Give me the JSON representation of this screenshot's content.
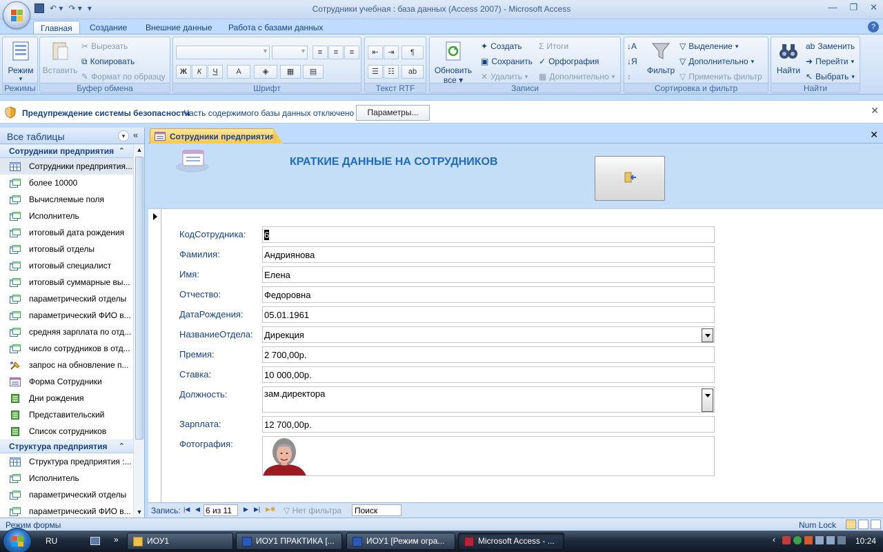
{
  "window": {
    "title": "Сотрудники учебная : база данных (Access 2007) - Microsoft Access",
    "minimize": "—",
    "restore": "❐",
    "close": "✕"
  },
  "ribbon_tabs": [
    {
      "label": "Главная",
      "active": true
    },
    {
      "label": "Создание",
      "active": false
    },
    {
      "label": "Внешние данные",
      "active": false
    },
    {
      "label": "Работа с базами данных",
      "active": false
    }
  ],
  "help_icon": "?",
  "ribbon": {
    "regimes": {
      "label": "Режимы",
      "button": "Режим"
    },
    "clipboard": {
      "label": "Буфер обмена",
      "paste": "Вставить",
      "cut": "Вырезать",
      "copy": "Копировать",
      "format_painter": "Формат по образцу"
    },
    "font": {
      "label": "Шрифт",
      "bold": "Ж",
      "italic": "К",
      "underline": "Ч",
      "font_color": "A"
    },
    "rtf": {
      "label": "Текст RTF"
    },
    "records": {
      "label": "Записи",
      "refresh": "Обновить",
      "refresh_sub": "все ▾",
      "new": "Создать",
      "save": "Сохранить",
      "delete": "Удалить",
      "totals": "Итоги",
      "spelling": "Орфография",
      "more": "Дополнительно"
    },
    "sort": {
      "label": "Сортировка и фильтр",
      "filter": "Фильтр",
      "selection": "Выделение",
      "advanced": "Дополнительно",
      "apply": "Применить фильтр"
    },
    "find": {
      "label": "Найти",
      "find": "Найти",
      "replace": "Заменить",
      "goto": "Перейти",
      "select": "Выбрать"
    }
  },
  "security_bar": {
    "title": "Предупреждение системы безопасности",
    "message": "Часть содержимого базы данных отключено",
    "button": "Параметры...",
    "close": "✕"
  },
  "nav_pane": {
    "header": "Все таблицы",
    "groups": [
      {
        "title": "Сотрудники предприятия",
        "items": [
          {
            "label": "Сотрудники предприятия...",
            "icon": "table-icon",
            "selected": true
          },
          {
            "label": "более 10000",
            "icon": "query-icon"
          },
          {
            "label": "Вычисляемые поля",
            "icon": "query-icon"
          },
          {
            "label": "Исполнитель",
            "icon": "query-icon"
          },
          {
            "label": "итоговый дата рождения",
            "icon": "query-icon"
          },
          {
            "label": "итоговый отделы",
            "icon": "query-icon"
          },
          {
            "label": "итоговый специалист",
            "icon": "query-icon"
          },
          {
            "label": "итоговый суммарные вы...",
            "icon": "query-icon"
          },
          {
            "label": "параметрический отделы",
            "icon": "query-icon"
          },
          {
            "label": "параметрический ФИО в...",
            "icon": "query-icon"
          },
          {
            "label": "средняя зарплата по отд...",
            "icon": "query-icon"
          },
          {
            "label": "число сотрудников в отд...",
            "icon": "query-icon"
          },
          {
            "label": "запрос на обновление п...",
            "icon": "update-query-icon"
          },
          {
            "label": "Форма Сотрудники",
            "icon": "form-icon"
          },
          {
            "label": "Дни рождения",
            "icon": "report-icon"
          },
          {
            "label": "Представительский",
            "icon": "report-icon"
          },
          {
            "label": "Список сотрудников",
            "icon": "report-icon"
          }
        ]
      },
      {
        "title": "Структура предприятия",
        "items": [
          {
            "label": "Структура предприятия :...",
            "icon": "table-icon"
          },
          {
            "label": "Исполнитель",
            "icon": "query-icon"
          },
          {
            "label": "параметрический отделы",
            "icon": "query-icon"
          },
          {
            "label": "параметрический ФИО в...",
            "icon": "query-icon"
          }
        ]
      }
    ]
  },
  "document_tab": {
    "label": "Сотрудники предприятия",
    "close": "✕"
  },
  "form": {
    "title": "КРАТКИЕ ДАННЫЕ НА СОТРУДНИКОВ",
    "fields": [
      {
        "label": "КодСотрудника:",
        "value": "6"
      },
      {
        "label": "Фамилия:",
        "value": "Андриянова"
      },
      {
        "label": "Имя:",
        "value": "Елена"
      },
      {
        "label": "Отчество:",
        "value": "Федоровна"
      },
      {
        "label": "ДатаРождения:",
        "value": "05.01.1961"
      },
      {
        "label": "НазваниеОтдела:",
        "value": "Дирекция"
      },
      {
        "label": "Премия:",
        "value": "2 700,00р."
      },
      {
        "label": "Ставка:",
        "value": "10 000,00р."
      },
      {
        "label": "Должность:",
        "value": "зам.директора"
      },
      {
        "label": "Зарплата:",
        "value": "12 700,00р."
      },
      {
        "label": "Фотография:",
        "value": ""
      }
    ]
  },
  "record_nav": {
    "label": "Запись:",
    "position": "6 из 11",
    "filter": "Нет фильтра",
    "search": "Поиск"
  },
  "status_bar": {
    "mode": "Режим формы",
    "num_lock": "Num Lock"
  },
  "taskbar": {
    "lang": "RU",
    "buttons": [
      {
        "label": "ИОУ1"
      },
      {
        "label": "ИОУ1 ПРАКТИКА [..."
      },
      {
        "label": "ИОУ1 [Режим огра..."
      },
      {
        "label": "Microsoft Access - ..."
      }
    ],
    "clock": "10:24"
  },
  "colors": {
    "accent": "#15428b",
    "ribbon_bg": "#d4e3f7",
    "tab_active": "#ffc84f",
    "form_header": "#c5def7",
    "form_title": "#1f6bbf"
  }
}
